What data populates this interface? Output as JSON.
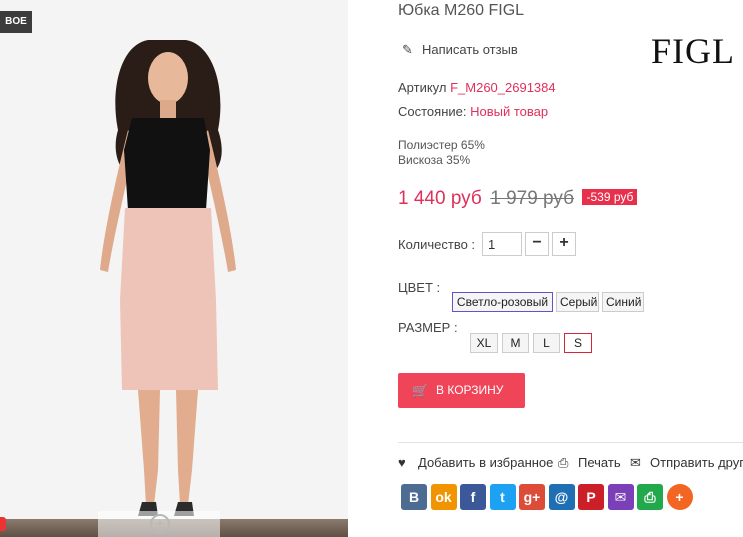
{
  "badge": {
    "text": "BOE"
  },
  "product": {
    "title": "Юбка M260 FIGL",
    "brand_logo": "FIGL",
    "review_link": "Написать отзыв",
    "article_label": "Артикул",
    "article_value": "F_M260_2691384",
    "condition_label": "Состояние:",
    "condition_value": "Новый товар",
    "composition": [
      "Полиэстер 65%",
      "Вискоза 35%"
    ],
    "price": "1 440 руб",
    "old_price": "1 979 руб",
    "discount": "-539 руб"
  },
  "quantity": {
    "label": "Количество :",
    "value": "1",
    "minus": "−",
    "plus": "+"
  },
  "color": {
    "label": "ЦВЕТ :",
    "options": [
      "Светло-розовый",
      "Серый",
      "Синий"
    ],
    "selected": "Светло-розовый"
  },
  "size": {
    "label": "РАЗМЕР :",
    "options": [
      "XL",
      "M",
      "L",
      "S"
    ],
    "selected": "S"
  },
  "cart": {
    "label": "В КОРЗИНУ"
  },
  "actions": {
    "wishlist": "Добавить в избранное",
    "print": "Печать",
    "send": "Отправить друг"
  },
  "share": [
    {
      "glyph": "B",
      "color": "#4c6c91",
      "icon": "vk-icon"
    },
    {
      "glyph": "ok",
      "color": "#f29400",
      "icon": "odnoklassniki-icon"
    },
    {
      "glyph": "f",
      "color": "#3b5998",
      "icon": "facebook-icon"
    },
    {
      "glyph": "t",
      "color": "#1da1f2",
      "icon": "twitter-icon"
    },
    {
      "glyph": "g+",
      "color": "#dd4b39",
      "icon": "google-plus-icon"
    },
    {
      "glyph": "@",
      "color": "#1f6fb4",
      "icon": "mailru-icon"
    },
    {
      "glyph": "P",
      "color": "#cb2027",
      "icon": "pinterest-icon"
    },
    {
      "glyph": "✉",
      "color": "#7b3fb8",
      "icon": "email-icon"
    },
    {
      "glyph": "⎙",
      "color": "#22a94c",
      "icon": "print-share-icon"
    },
    {
      "glyph": "+",
      "color": "#f26522",
      "icon": "more-share-icon"
    }
  ]
}
